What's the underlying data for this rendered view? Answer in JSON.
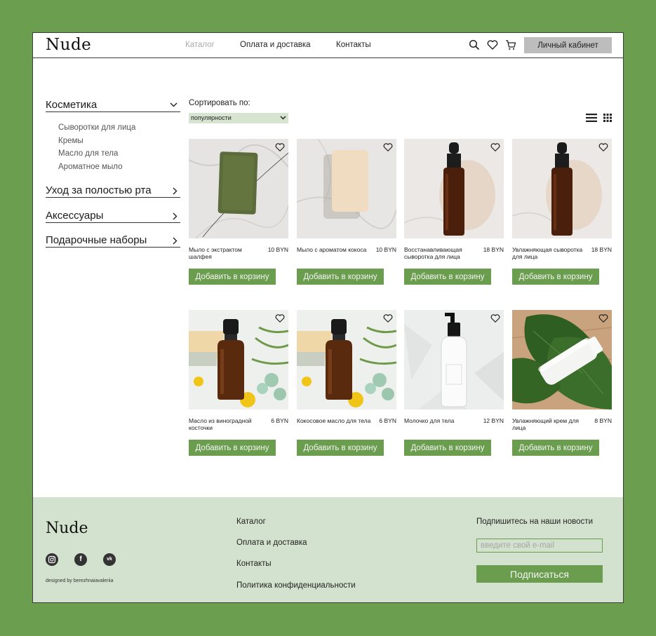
{
  "brand": "Nude",
  "nav": {
    "catalog": "Каталог",
    "delivery": "Оплата и доставка",
    "contacts": "Контакты",
    "cabinet": "Личный кабинет"
  },
  "sidebar": {
    "categories": [
      {
        "label": "Косметика",
        "expanded": true,
        "items": [
          "Сыворотки для лица",
          "Кремы",
          "Масло для тела",
          "Ароматное мыло"
        ]
      },
      {
        "label": "Уход за полостью рта"
      },
      {
        "label": "Аксессуары"
      },
      {
        "label": "Подарочные наборы"
      }
    ]
  },
  "sort": {
    "label": "Сортировать по:",
    "value": "популярности"
  },
  "products": [
    {
      "name": "Мыло с экстрактом шалфея",
      "price": "10 BYN",
      "button": "Добавить в корзину"
    },
    {
      "name": "Мыло с ароматом кокоса",
      "price": "10 BYN",
      "button": "Добавить в корзину"
    },
    {
      "name": "Восстанавливающая сыворотка для лица",
      "price": "18 BYN",
      "button": "Добавить в корзину"
    },
    {
      "name": "Увлажняющая сыворотка для лица",
      "price": "18 BYN",
      "button": "Добавить в корзину"
    },
    {
      "name": "Масло из виноградной косточки",
      "price": "6 BYN",
      "button": "Добавить в корзину"
    },
    {
      "name": "Кокосовое масло для тела",
      "price": "6 BYN",
      "button": "Добавить в корзину"
    },
    {
      "name": "Молочко для тела",
      "price": "12 BYN",
      "button": "Добавить в корзину"
    },
    {
      "name": "Увлажняющий крем для лица",
      "price": "8 BYN",
      "button": "Добавить в корзину"
    }
  ],
  "footer": {
    "brand": "Nude",
    "links": [
      "Каталог",
      "Оплата и доставка",
      "Контакты",
      "Политика конфиденциальности"
    ],
    "social": [
      "instagram-icon",
      "facebook-icon",
      "vk-icon"
    ],
    "designed_by": "designed by berezhnaiavaleriia",
    "subscribe_title": "Подпишитесь на наши новости",
    "email_placeholder": "введите свой e-mail",
    "subscribe_button": "Подписаться"
  },
  "colors": {
    "accent": "#6a9d4e",
    "background": "#6b9e4e",
    "footer": "#d3e2ce",
    "select": "#d7e4d0"
  }
}
